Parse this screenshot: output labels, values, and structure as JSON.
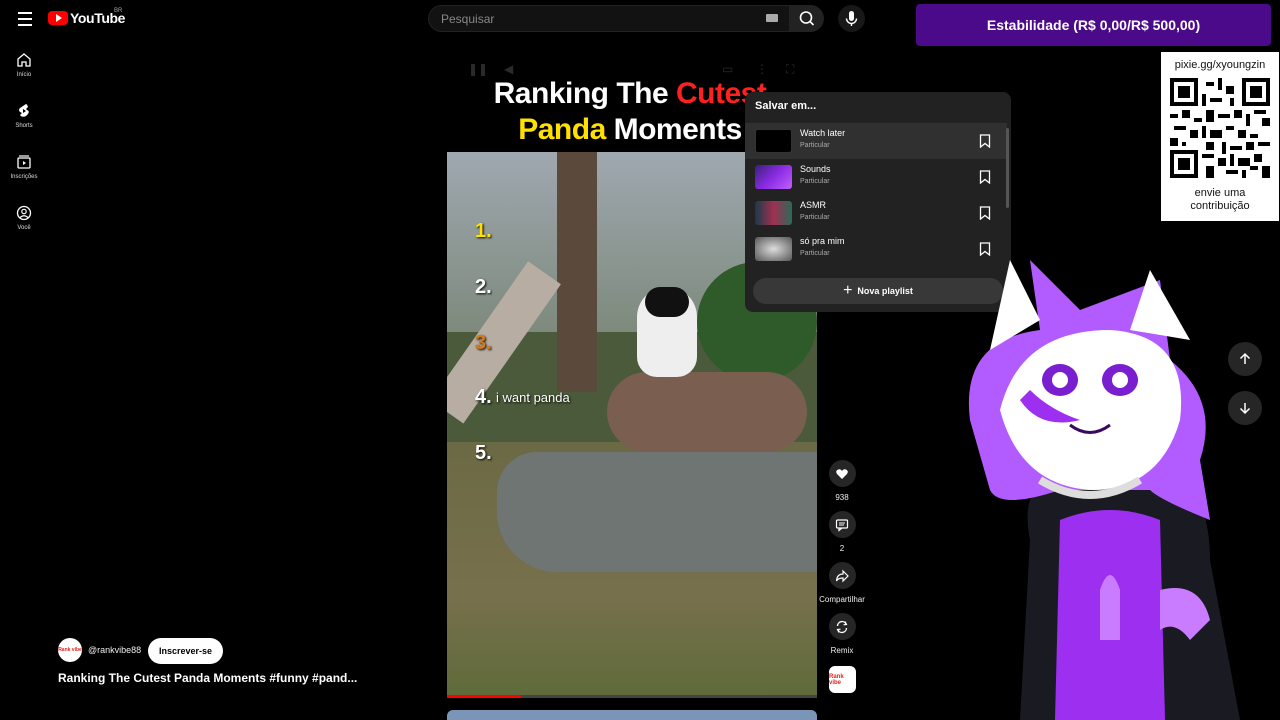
{
  "header": {
    "logo_text": "YouTube",
    "region": "BR",
    "search_placeholder": "Pesquisar"
  },
  "sidebar": {
    "items": [
      {
        "label": "Início",
        "icon": "home-icon"
      },
      {
        "label": "Shorts",
        "icon": "shorts-icon"
      },
      {
        "label": "Inscrições",
        "icon": "subscriptions-icon"
      },
      {
        "label": "Você",
        "icon": "account-icon"
      }
    ]
  },
  "banner": {
    "stability": "Estabilidade (R$ 0,00/R$ 500,00)"
  },
  "video": {
    "title_line1_a": "Ranking The ",
    "title_line1_b": "Cutest",
    "title_line2_a": "Panda",
    "title_line2_b": " Moments",
    "ranks": [
      "1.",
      "2.",
      "3.",
      "4.",
      "5."
    ],
    "rank4_caption": "i want panda",
    "progress_fraction": 0.2
  },
  "actions": {
    "likes": "938",
    "comments": "2",
    "share_label": "Compartilhar",
    "remix_label": "Remix"
  },
  "channel": {
    "handle": "@rankvibe88",
    "avatar_text": "Rank vibe",
    "subscribe_label": "Inscrever-se",
    "short_title": "Ranking The Cutest Panda Moments #funny #pand..."
  },
  "save_popup": {
    "heading": "Salvar em...",
    "playlists": [
      {
        "name": "Watch later",
        "privacy": "Particular",
        "thumb_color": "#000000"
      },
      {
        "name": "Sounds",
        "privacy": "Particular",
        "thumb_color": "#8a2be2"
      },
      {
        "name": "ASMR",
        "privacy": "Particular",
        "thumb_color": "#2a6a5a"
      },
      {
        "name": "só pra mim",
        "privacy": "Particular",
        "thumb_color": "#9a9a9a"
      }
    ],
    "new_playlist_label": "Nova playlist"
  },
  "donation": {
    "url": "pixie.gg/xyoungzin",
    "line1": "envie uma",
    "line2": "contribuição"
  },
  "colors": {
    "accent_red": "#ff0000",
    "banner_purple": "#4b0a8a"
  }
}
